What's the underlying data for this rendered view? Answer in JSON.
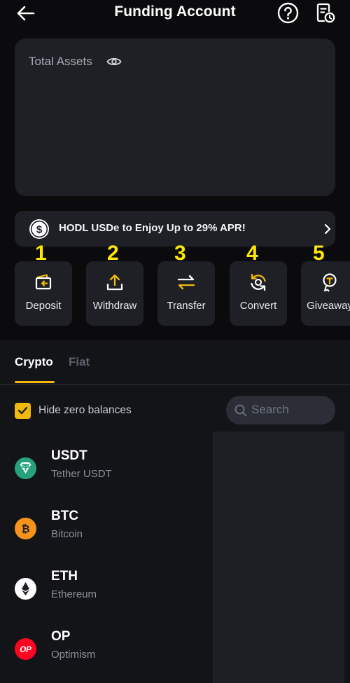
{
  "header": {
    "title": "Funding Account",
    "back_icon": "arrow-left-icon",
    "help_icon": "question-circle-icon",
    "records_icon": "document-clock-icon"
  },
  "assets": {
    "label": "Total Assets",
    "eye_icon": "eye-icon"
  },
  "banner": {
    "icon": "dollar-coin-icon",
    "text": "HODL USDe to Enjoy Up to 29% APR!",
    "chevron_icon": "chevron-right-icon"
  },
  "annotations": [
    "1",
    "2",
    "3",
    "4",
    "5"
  ],
  "actions": [
    {
      "label": "Deposit",
      "icon": "deposit-icon"
    },
    {
      "label": "Withdraw",
      "icon": "upload-icon"
    },
    {
      "label": "Transfer",
      "icon": "transfer-arrows-icon"
    },
    {
      "label": "Convert",
      "icon": "convert-icon"
    },
    {
      "label": "Giveaway",
      "icon": "giveaway-icon"
    }
  ],
  "tabs": [
    {
      "label": "Crypto",
      "active": true
    },
    {
      "label": "Fiat",
      "active": false
    }
  ],
  "filters": {
    "hide_zero_label": "Hide zero balances",
    "hide_zero_checked": true,
    "search_placeholder": "Search"
  },
  "coins": [
    {
      "symbol": "USDT",
      "name": "Tether USDT",
      "icon": "usdt-icon",
      "color": "#26a17b"
    },
    {
      "symbol": "BTC",
      "name": "Bitcoin",
      "icon": "btc-icon",
      "color": "#f7931a"
    },
    {
      "symbol": "ETH",
      "name": "Ethereum",
      "icon": "eth-icon",
      "color": "#ffffff"
    },
    {
      "symbol": "OP",
      "name": "Optimism",
      "icon": "op-icon",
      "color": "#ff0420"
    }
  ],
  "colors": {
    "accent": "#f0b90b",
    "annotation": "#ffe600",
    "background": "#0b0b0d",
    "card": "#1e2026"
  }
}
